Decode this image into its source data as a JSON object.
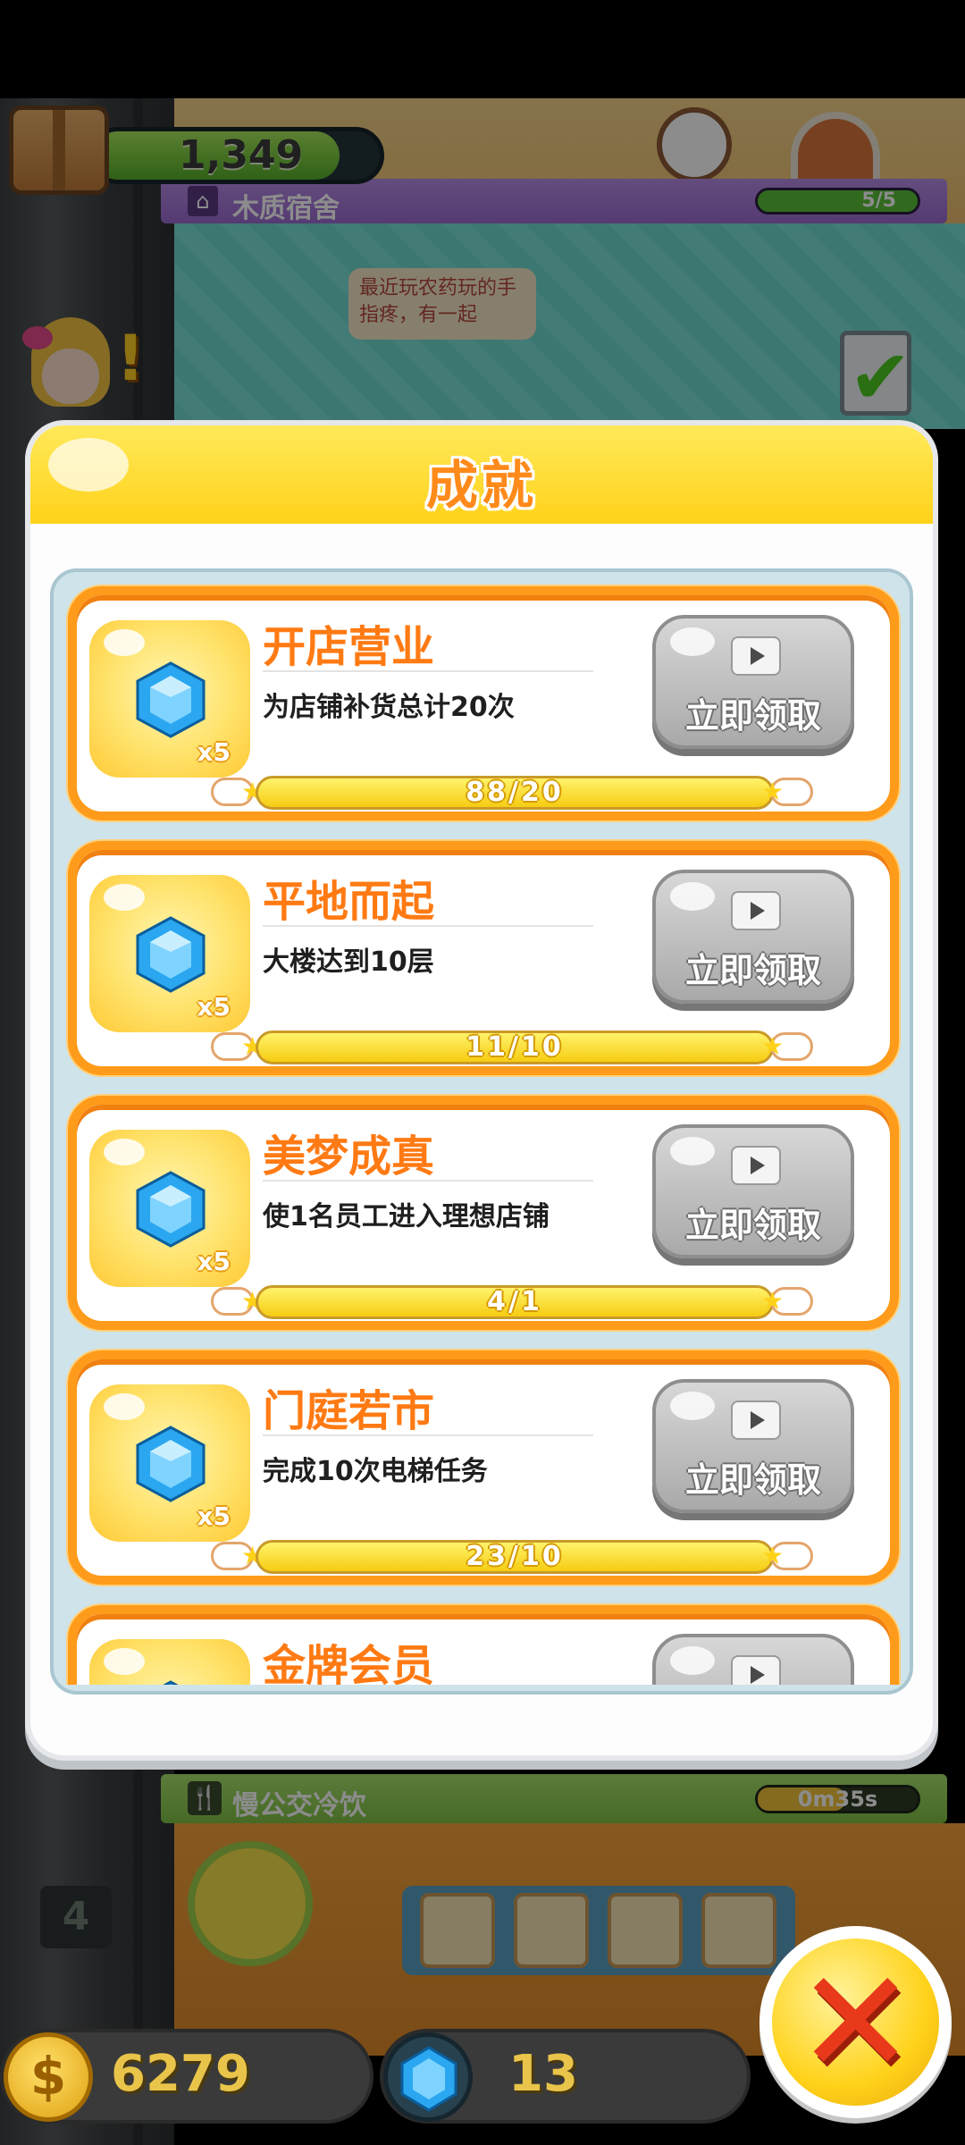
{
  "top_counter": {
    "value": "1,349",
    "progress": 0.86
  },
  "dorm": {
    "name": "木质宿舍",
    "progress_text": "5/5",
    "progress": 1.0
  },
  "speech_bubble": "最近玩农药玩的手指疼，有一起",
  "panel": {
    "title": "成就",
    "claim_label": "立即领取",
    "achievements": [
      {
        "title": "开店营业",
        "desc": "为店铺补货总计20次",
        "reward_qty": "x5",
        "progress_text": "88/20",
        "progress": 1.0
      },
      {
        "title": "平地而起",
        "desc": "大楼达到10层",
        "reward_qty": "x5",
        "progress_text": "11/10",
        "progress": 1.0
      },
      {
        "title": "美梦成真",
        "desc": "使1名员工进入理想店铺",
        "reward_qty": "x5",
        "progress_text": "4/1",
        "progress": 1.0
      },
      {
        "title": "门庭若市",
        "desc": "完成10次电梯任务",
        "reward_qty": "x5",
        "progress_text": "23/10",
        "progress": 1.0
      },
      {
        "title": "金牌会员",
        "desc": "",
        "reward_qty": "",
        "progress_text": "",
        "progress": 1.0
      }
    ]
  },
  "drink_shop": {
    "name": "慢公交冷饮",
    "timer": "0m35s",
    "timer_progress": 0.55
  },
  "floor_number": "4",
  "currency": {
    "coins": "6279",
    "gems": "13"
  },
  "colors": {
    "accent_orange": "#ff9b1a",
    "header_yellow": "#ffd21a",
    "gem_blue": "#2aa7f0"
  },
  "icons": [
    "box-icon",
    "home-icon",
    "check-icon",
    "gem-icon",
    "play-icon",
    "fork-knife-icon",
    "coin-icon",
    "close-icon"
  ]
}
